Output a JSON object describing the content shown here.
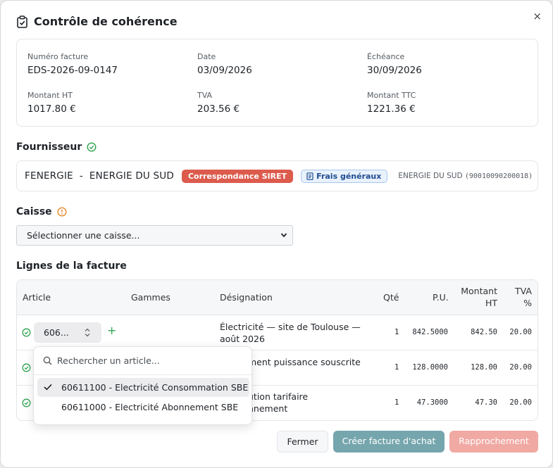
{
  "dialog": {
    "title": "Contrôle de cohérence",
    "close_glyph": "×"
  },
  "invoice": {
    "numero_label": "Numéro facture",
    "numero_value": "EDS-2026-09-0147",
    "date_label": "Date",
    "date_value": "03/09/2026",
    "echeance_label": "Échéance",
    "echeance_value": "30/09/2026",
    "ht_label": "Montant HT",
    "ht_value": "1017.80 €",
    "tva_label": "TVA",
    "tva_value": "203.56 €",
    "ttc_label": "Montant TTC",
    "ttc_value": "1221.36 €"
  },
  "supplier": {
    "heading": "Fournisseur",
    "status_icon": "check-circle-icon",
    "name": "FENERGIE  -  ENERGIE DU SUD",
    "siret_badge": "Correspondance SIRET",
    "category_badge": "Frais généraux",
    "code_name": "ENERGIE DU SUD",
    "code_siret": "(90010090200018)"
  },
  "caisse": {
    "heading": "Caisse",
    "status_icon": "warning-circle-icon",
    "select_value": "Sélectionner une caisse..."
  },
  "lines": {
    "heading": "Lignes de la facture",
    "columns": {
      "article": "Article",
      "gammes": "Gammes",
      "designation": "Désignation",
      "qte": "Qté",
      "pu": "P.U.",
      "montant_1": "Montant",
      "montant_2": "HT",
      "tva_1": "TVA",
      "tva_2": "%"
    },
    "rows": [
      {
        "article": "606...",
        "designation_1": "Électricité — site de Toulouse —",
        "designation_2": "août 2026",
        "qte": "1",
        "pu": "842.5000",
        "montant": "842.50",
        "tva": "20.00"
      },
      {
        "designation_1": "ment puissance souscrite",
        "designation_2": "",
        "qte": "1",
        "pu": "128.0000",
        "montant": "128.00",
        "tva": "20.00"
      },
      {
        "designation_1": "ution tarifaire",
        "designation_2": "nnement",
        "qte": "1",
        "pu": "47.3000",
        "montant": "47.30",
        "tva": "20.00"
      }
    ]
  },
  "article_dropdown": {
    "placeholder": "Rechercher un article...",
    "options": [
      {
        "label": "60611100 - Electricité Consommation SBE",
        "selected": true
      },
      {
        "label": "60611000 - Electricité Abonnement SBE",
        "selected": false
      }
    ]
  },
  "footer": {
    "close_label": "Fermer",
    "create_label": "Créer facture d'achat",
    "rapprochement_label": "Rapprochement"
  },
  "colors": {
    "success": "#2ea44f",
    "warning": "#e8892b",
    "siret_badge": "#dc5b4d",
    "create_button": "#76a6ad",
    "rapprochement_button": "#f0a9a3"
  }
}
